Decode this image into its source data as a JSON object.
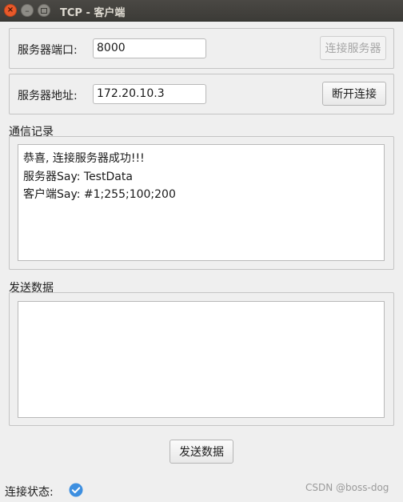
{
  "window": {
    "title": "TCP - 客户端",
    "close_glyph": "×",
    "minimize_glyph": "–"
  },
  "port_group": {
    "label": "服务器端口:",
    "value": "8000",
    "connect_button": "连接服务器",
    "connect_enabled": false
  },
  "address_group": {
    "label": "服务器地址:",
    "value": "172.20.10.3",
    "disconnect_button": "断开连接"
  },
  "log_section": {
    "label": "通信记录",
    "lines": [
      "恭喜, 连接服务器成功!!!",
      "服务器Say: TestData",
      "客户端Say: #1;255;100;200"
    ]
  },
  "send_section": {
    "label": "发送数据",
    "content": "",
    "send_button": "发送数据"
  },
  "status": {
    "label": "连接状态:",
    "icon": "check-circle-icon",
    "icon_color": "#3d8fe0"
  },
  "watermark": "CSDN @boss-dog",
  "colors": {
    "titlebar": "#3c3b37",
    "close_button": "#e9592a",
    "window_bg": "#efefef"
  }
}
